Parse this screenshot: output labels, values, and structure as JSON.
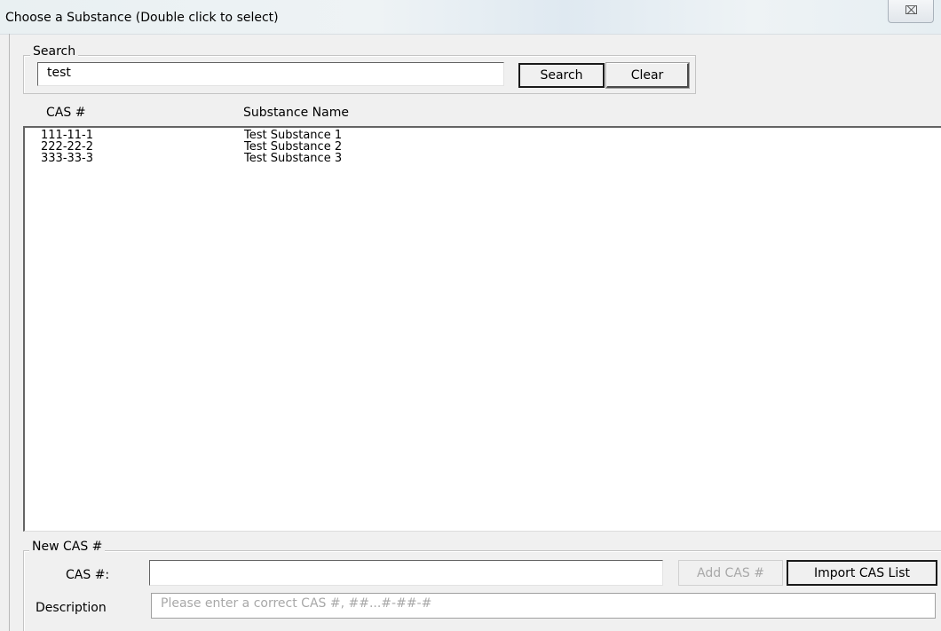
{
  "window": {
    "title": "Choose a Substance (Double click to select)",
    "close_glyph": "⌧"
  },
  "search": {
    "group_label": "Search",
    "value": "test",
    "search_button": "Search",
    "clear_button": "Clear"
  },
  "list": {
    "columns": [
      "CAS #",
      "Substance Name"
    ],
    "rows": [
      {
        "cas": "111-11-1",
        "name": "Test Substance 1"
      },
      {
        "cas": "222-22-2",
        "name": "Test Substance 2"
      },
      {
        "cas": "333-33-3",
        "name": "Test Substance 3"
      }
    ]
  },
  "new_cas": {
    "group_label": "New CAS #",
    "cas_label": "CAS #:",
    "cas_value": "",
    "add_button": "Add CAS #",
    "import_button": "Import CAS List",
    "description_label": "Description",
    "description_text": "Please enter a correct CAS #, ##...#-##-#"
  }
}
